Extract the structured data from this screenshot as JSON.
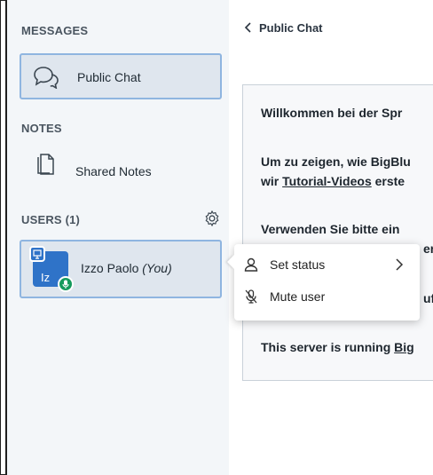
{
  "sidebar": {
    "messages_title": "MESSAGES",
    "public_chat_label": "Public Chat",
    "notes_title": "NOTES",
    "shared_notes_label": "Shared Notes",
    "users_title": "USERS (1)",
    "user": {
      "initials": "Iz",
      "name": "Izzo Paolo",
      "you_tag": "(You)"
    }
  },
  "chat": {
    "back_label": "Public Chat",
    "messages": [
      "Willkommen bei der Spr",
      "Um zu zeigen, wie BigBlu",
      "wir",
      "Tutorial-Videos",
      "erste",
      "Verwenden Sie bitte ein",
      "er",
      "uf",
      "This server is running",
      "Big"
    ]
  },
  "context_menu": {
    "set_status": "Set status",
    "mute_user": "Mute user"
  },
  "colors": {
    "accent_blue": "#2f73c8",
    "selected_border": "#8fb5e0",
    "mic_green": "#149a5c"
  }
}
